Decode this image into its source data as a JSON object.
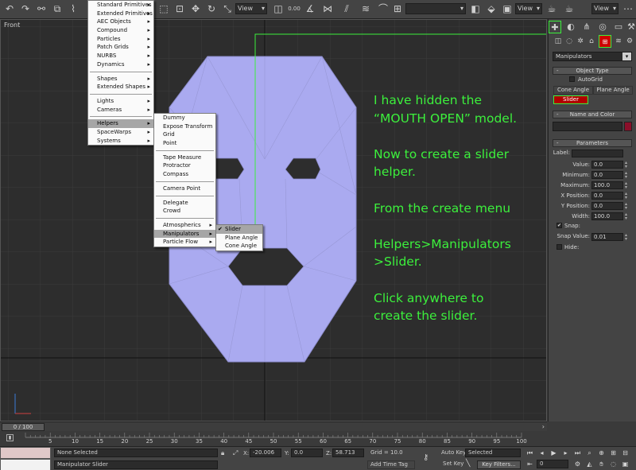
{
  "toolbar": {
    "view_label_1": "View",
    "view_label_2": "View",
    "snap_value": "0.00",
    "selection_set": ""
  },
  "viewport": {
    "label": "Front"
  },
  "tutorial": {
    "lines": [
      "I have hidden the",
      "“MOUTH OPEN” model.",
      "",
      "Now to create a slider",
      "helper.",
      "",
      "From the create menu",
      "",
      "Helpers>Manipulators",
      ">Slider.",
      "",
      "Click anywhere to",
      "create the slider."
    ]
  },
  "create_menu": {
    "items": [
      {
        "label": "Standard Primitives",
        "sub": true
      },
      {
        "label": "Extended Primitives",
        "sub": true
      },
      {
        "label": "AEC Objects",
        "sub": true
      },
      {
        "label": "Compound",
        "sub": true
      },
      {
        "label": "Particles",
        "sub": true
      },
      {
        "label": "Patch Grids",
        "sub": true
      },
      {
        "label": "NURBS",
        "sub": true
      },
      {
        "label": "Dynamics",
        "sub": true
      },
      {
        "sep": true
      },
      {
        "label": "Shapes",
        "sub": true
      },
      {
        "label": "Extended Shapes",
        "sub": true
      },
      {
        "sep": true
      },
      {
        "label": "Lights",
        "sub": true
      },
      {
        "label": "Cameras",
        "sub": true
      },
      {
        "sep": true
      },
      {
        "label": "Helpers",
        "sub": true,
        "hl": true
      },
      {
        "label": "SpaceWarps",
        "sub": true
      },
      {
        "label": "Systems",
        "sub": true
      }
    ]
  },
  "helpers_menu": {
    "items": [
      {
        "label": "Dummy"
      },
      {
        "label": "Expose Transform"
      },
      {
        "label": "Grid"
      },
      {
        "label": "Point"
      },
      {
        "sep": true
      },
      {
        "label": "Tape Measure"
      },
      {
        "label": "Protractor"
      },
      {
        "label": "Compass"
      },
      {
        "sep": true
      },
      {
        "label": "Camera Point"
      },
      {
        "sep": true
      },
      {
        "label": "Delegate"
      },
      {
        "label": "Crowd"
      },
      {
        "sep": true
      },
      {
        "label": "Atmospherics",
        "sub": true
      },
      {
        "label": "Manipulators",
        "sub": true,
        "hl": true
      },
      {
        "label": "Particle Flow",
        "sub": true
      }
    ]
  },
  "manipulators_menu": {
    "items": [
      {
        "label": "Slider",
        "hl": true,
        "check": "✔"
      },
      {
        "label": "Plane Angle"
      },
      {
        "label": "Cone Angle"
      }
    ]
  },
  "panel": {
    "category": "Manipulators",
    "object_type_title": "Object Type",
    "autogrid": "AutoGrid",
    "cone_angle": "Cone Angle",
    "plane_angle": "Plane Angle",
    "slider": "Slider",
    "name_color_title": "Name and Color",
    "name_value": "",
    "parameters_title": "Parameters",
    "label_label": "Label:",
    "label_value": "",
    "params": [
      {
        "label": "Value:",
        "value": "0.0"
      },
      {
        "label": "Minimum:",
        "value": "0.0"
      },
      {
        "label": "Maximum:",
        "value": "100.0"
      },
      {
        "label": "X Position:",
        "value": "0.0"
      },
      {
        "label": "Y Position:",
        "value": "0.0"
      },
      {
        "label": "Width:",
        "value": "100.0"
      }
    ],
    "snap_label": "Snap:",
    "snap_value_label": "Snap Value:",
    "snap_value": "0.01",
    "hide_label": "Hide:",
    "object_color": "#8b0f2a",
    "highlight_color": "#cc0000"
  },
  "timeline": {
    "frame": "0 / 100",
    "ticks": [
      "5",
      "10",
      "15",
      "20",
      "25",
      "30",
      "35",
      "40",
      "45",
      "50",
      "55",
      "60",
      "65",
      "70",
      "75",
      "80",
      "85",
      "90",
      "95",
      "100"
    ]
  },
  "status": {
    "selection": "None Selected",
    "prompt": "Manipulator Slider",
    "x_label": "X:",
    "x_value": "-20.006",
    "y_label": "Y:",
    "y_value": "0.0",
    "z_label": "Z:",
    "z_value": "58.713",
    "grid": "Grid = 10.0",
    "add_time_tag": "Add Time Tag",
    "auto_key": "Auto Key",
    "set_key": "Set Key",
    "key_mode": "Selected",
    "key_filters": "Key Filters...",
    "current_frame": "0"
  },
  "colors": {
    "mesh_fill": "#aaaaf0",
    "annotation_green": "#3cf03c"
  }
}
